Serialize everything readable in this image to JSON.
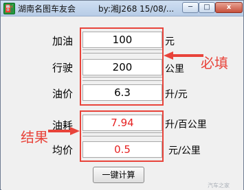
{
  "window": {
    "title": "湖南名图车友会",
    "title_right": "by:湘J268   15/08/..."
  },
  "controls": {
    "minimize": "─",
    "maximize": "□",
    "close": "x"
  },
  "inputs": [
    {
      "label": "加油",
      "value": "100",
      "unit": "元"
    },
    {
      "label": "行驶",
      "value": "200",
      "unit": "公里"
    },
    {
      "label": "油价",
      "value": "6.3",
      "unit": "升/元"
    }
  ],
  "results": [
    {
      "label": "油耗",
      "value": "7.94",
      "unit": "升/百公里"
    },
    {
      "label": "均价",
      "value": "0.5",
      "unit": "元/公里"
    }
  ],
  "annotations": {
    "required": "必填",
    "result": "结果"
  },
  "button": {
    "label": "一键计算"
  },
  "watermark": "汽车之家",
  "colors": {
    "annotation": "#e8433a",
    "result_text": "#e62222"
  }
}
